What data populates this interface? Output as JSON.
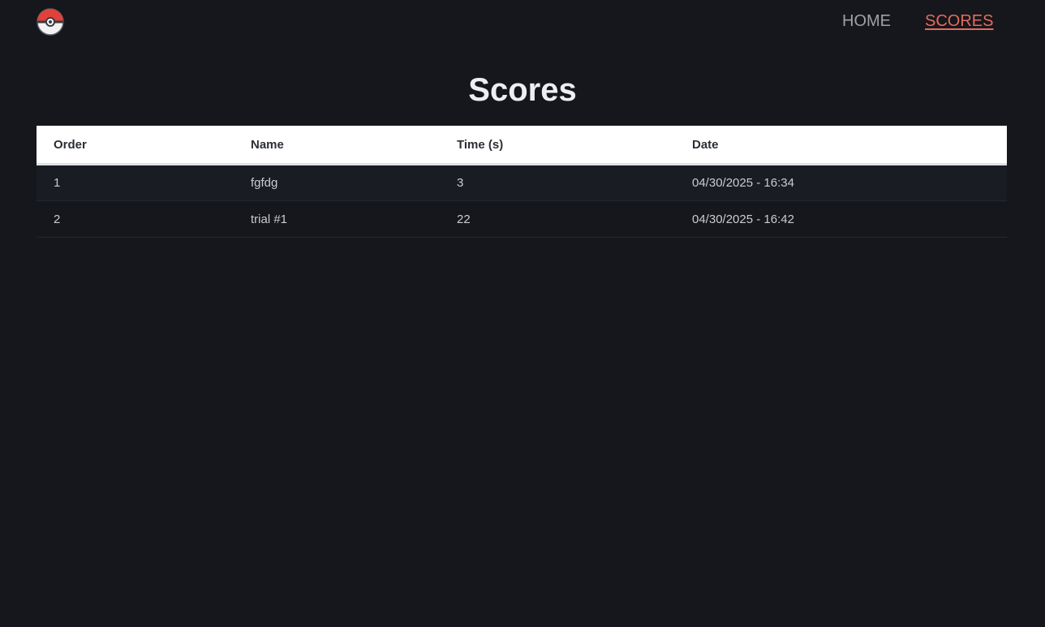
{
  "nav": {
    "logo_icon": "pokeball-icon",
    "home_label": "HOME",
    "scores_label": "SCORES",
    "active_color": "#e56b5c"
  },
  "page": {
    "title": "Scores"
  },
  "table": {
    "headers": [
      "Order",
      "Name",
      "Time (s)",
      "Date"
    ],
    "rows": [
      [
        "1",
        "fgfdg",
        "3",
        "04/30/2025 - 16:34"
      ],
      [
        "2",
        "trial #1",
        "22",
        "04/30/2025 - 16:42"
      ]
    ]
  }
}
